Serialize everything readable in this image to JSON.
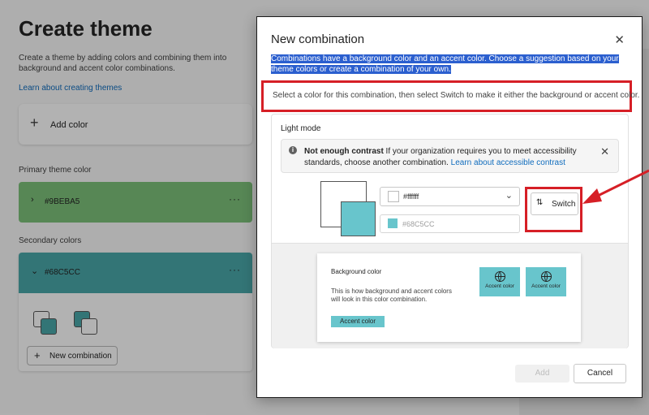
{
  "background": {
    "title": "Create theme",
    "description": "Create a theme by adding colors and combining them into background and accent color combinations.",
    "learn_link": "Learn about creating themes",
    "add_color_label": "Add color",
    "primary_label": "Primary theme color",
    "primary_hex": "#9BEBA5",
    "primary_color": "#7dc27a",
    "secondary_label": "Secondary colors",
    "secondary_hex": "#68C5CC",
    "secondary_color": "#4aa8aa",
    "new_combination_label": "New combination",
    "menu_dots": "···"
  },
  "dialog": {
    "title": "New combination",
    "intro": "Combinations have a background color and an accent color. Choose a suggestion based on your theme colors or create a combination of your own.",
    "instruction": "Select a color for this combination, then select Switch to make it either the background or accent color.",
    "light_mode_label": "Light mode",
    "warning": {
      "bold": "Not enough contrast",
      "text": " If your organization requires you to meet accessibility standards, choose another combination. ",
      "link": "Learn about accessible contrast"
    },
    "background_value": "#ffffff",
    "accent_value": "#68C5CC",
    "switch_label": "Switch",
    "preview": {
      "title": "Background color",
      "description": "This is how background and accent colors will look in this color combination.",
      "chip_label": "Accent color",
      "tile1_label": "Accent color",
      "tile2_label": "Accent color"
    },
    "add_label": "Add",
    "cancel_label": "Cancel"
  },
  "colors": {
    "accent": "#68C5CC",
    "highlight_red": "#d61f26",
    "selection_blue": "#2b5fcf"
  }
}
